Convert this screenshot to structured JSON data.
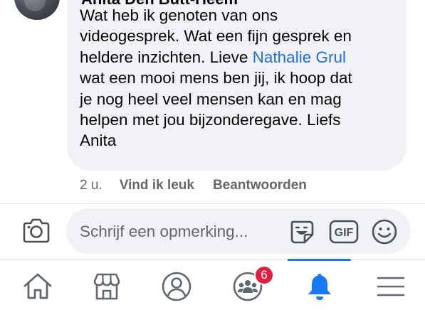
{
  "comment": {
    "author": "Anita Den Butt-Heem",
    "text_lines": [
      "Wat heb ik genoten van ons",
      "videogesprek. Wat een fijn gesprek en",
      "heldere inzichten. Lieve ",
      "wat een mooi mens ben jij, ik hoop dat",
      "je nog heel veel mensen kan en mag",
      "helpen met jou bijzonderegave. Liefs",
      "Anita"
    ],
    "mention": "Nathalie Grul",
    "time": "2 u.",
    "like_label": "Vind ik leuk",
    "reply_label": "Beantwoorden"
  },
  "composer": {
    "placeholder": "Schrijf een opmerking...",
    "gif_label": "GIF"
  },
  "nav": {
    "items": [
      {
        "icon": "home-icon"
      },
      {
        "icon": "marketplace-icon"
      },
      {
        "icon": "profile-icon"
      },
      {
        "icon": "groups-icon",
        "badge": "6"
      },
      {
        "icon": "notifications-icon",
        "active": true
      },
      {
        "icon": "menu-icon"
      }
    ]
  },
  "colors": {
    "accent": "#1877f2",
    "mention": "#216fdb",
    "badge": "#e41e3f",
    "bubble": "#f0f2f5",
    "muted_text": "#65676b"
  }
}
